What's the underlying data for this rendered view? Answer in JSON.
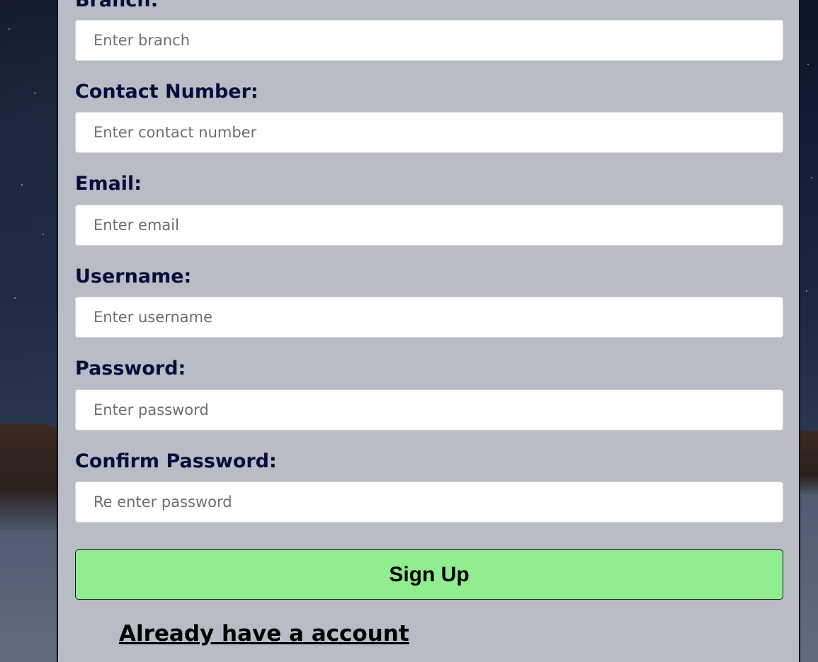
{
  "form": {
    "branch": {
      "label": "Branch:",
      "placeholder": "Enter branch"
    },
    "contact": {
      "label": "Contact Number:",
      "placeholder": "Enter contact number"
    },
    "email": {
      "label": "Email:",
      "placeholder": "Enter email"
    },
    "username": {
      "label": "Username:",
      "placeholder": "Enter username"
    },
    "password": {
      "label": "Password:",
      "placeholder": "Enter password"
    },
    "confirm": {
      "label": "Confirm Password:",
      "placeholder": "Re enter password"
    },
    "submit_label": "Sign Up",
    "login_link": "Already have a account"
  },
  "colors": {
    "panel": "#b8bcc4",
    "label": "#0b0b3d",
    "submit": "#90ee90"
  }
}
